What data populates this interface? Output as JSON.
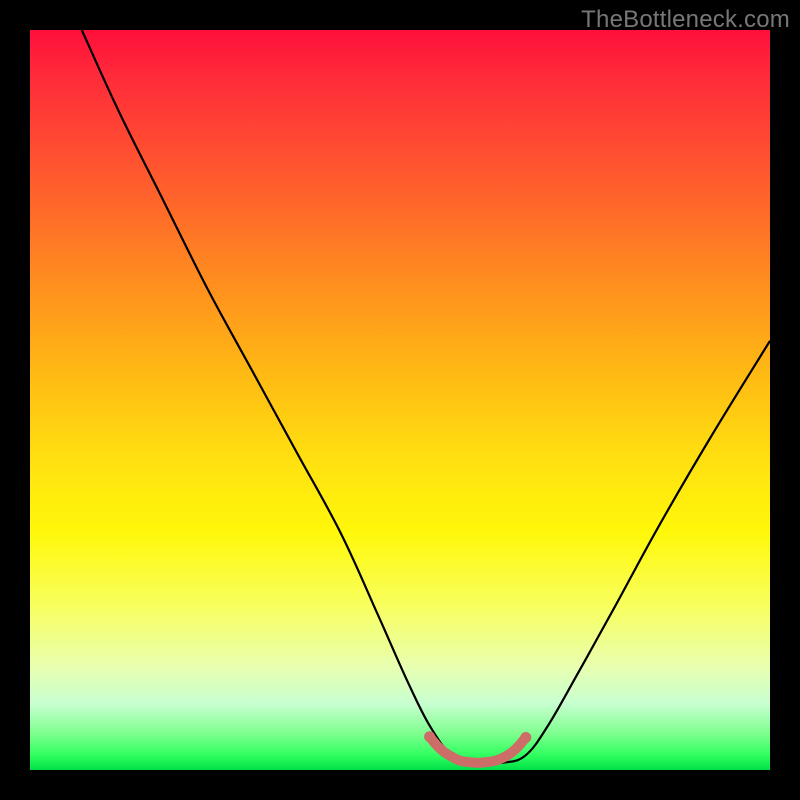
{
  "watermark": "TheBottleneck.com",
  "chart_data": {
    "type": "line",
    "title": "",
    "xlabel": "",
    "ylabel": "",
    "xlim": [
      0,
      100
    ],
    "ylim": [
      0,
      100
    ],
    "series": [
      {
        "name": "curve",
        "color": "#000000",
        "x": [
          7,
          12,
          18,
          24,
          30,
          36,
          42,
          47,
          51,
          54,
          57,
          60,
          64,
          67,
          70,
          74,
          79,
          85,
          92,
          100
        ],
        "y": [
          100,
          89,
          77,
          65,
          54,
          43,
          32,
          21,
          12,
          6,
          2,
          1,
          1,
          2,
          6,
          13,
          22,
          33,
          45,
          58
        ]
      },
      {
        "name": "trough-highlight",
        "color": "#cc6e67",
        "x": [
          54,
          55,
          56,
          57,
          58,
          59,
          60,
          61,
          62,
          63,
          64,
          65,
          66,
          67
        ],
        "y": [
          4.5,
          3.3,
          2.4,
          1.8,
          1.3,
          1.1,
          1.0,
          1.0,
          1.1,
          1.3,
          1.7,
          2.3,
          3.2,
          4.4
        ]
      }
    ],
    "annotations": []
  }
}
